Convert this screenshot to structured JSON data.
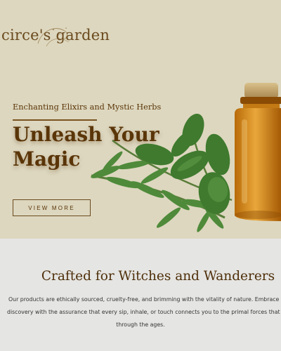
{
  "brand": {
    "name": "circe's garden"
  },
  "hero": {
    "tagline": "Enchanting Elixirs and Mystic Herbs",
    "headline_line1": "Unleash Your",
    "headline_line2": "Magic",
    "cta_label": "VIEW MORE"
  },
  "section": {
    "title": "Crafted for Witches and Wanderers",
    "body_line1": "Our products are ethically sourced, cruelty-free, and brimming with the vitality of nature. Embrace the journ",
    "body_line2": "discovery with the assurance that every sip, inhale, or touch connects you to the primal forces that have guid",
    "body_line3": "through the ages."
  },
  "colors": {
    "hero_bg": "#ddd7bf",
    "brand_brown": "#5a3508",
    "section_bg": "#e5e5e3",
    "oil_amber": "#d08a1a",
    "herb_green": "#4f8a3a"
  },
  "icons": [
    "logo-swirl-icon",
    "rosemary-herb-icon",
    "oil-bottle-icon"
  ]
}
